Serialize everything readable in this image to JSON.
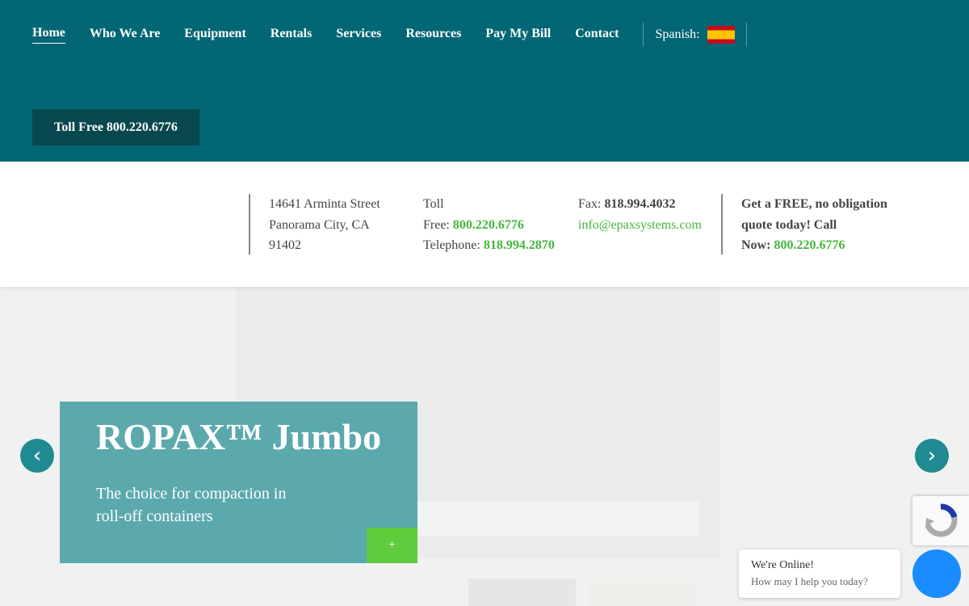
{
  "nav": {
    "items": [
      {
        "label": "Home"
      },
      {
        "label": "Who We Are"
      },
      {
        "label": "Equipment"
      },
      {
        "label": "Rentals"
      },
      {
        "label": "Services"
      },
      {
        "label": "Resources"
      },
      {
        "label": "Pay My Bill"
      },
      {
        "label": "Contact"
      }
    ],
    "language_label": "Spanish:",
    "flag_icon": "spain-flag-icon"
  },
  "toll_button": {
    "label": "Toll Free 800.220.6776"
  },
  "info": {
    "address": [
      "14641 Arminta Street",
      "Panorama City, CA",
      "91402"
    ],
    "toll_label": "Toll",
    "free_label": "Free:",
    "toll_number": "800.220.6776",
    "telephone_label": "Telephone:",
    "telephone_number": "818.994.2870",
    "fax_label": "Fax:",
    "fax_number": "818.994.4032",
    "email": "info@epaxsystems.com",
    "quote_line1": "Get a FREE, no obligation",
    "quote_line2": "quote today! Call",
    "quote_line3": "Now:",
    "quote_number": "800.220.6776"
  },
  "slider": {
    "title": "ROPAX™ Jumbo",
    "subtitle": "The choice for compaction in roll-off containers",
    "plus_label": "+",
    "prev_icon": "‹",
    "next_icon": "›"
  },
  "chat": {
    "title": "We're Online!",
    "subtitle": "How may I help you today?"
  },
  "colors": {
    "header": "#026674",
    "accent_green": "#44b63b",
    "caption_bg": "#5ba9ad",
    "chat_blue": "#1a8cff"
  }
}
